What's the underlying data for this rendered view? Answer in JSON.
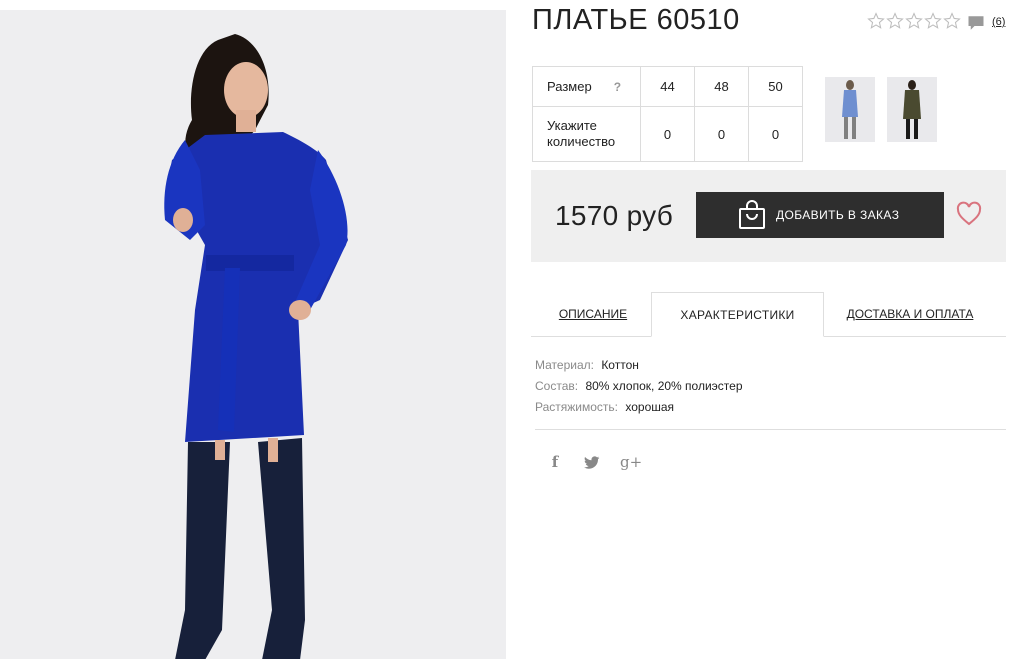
{
  "product": {
    "title": "ПЛАТЬЕ 60510",
    "reviews_count": "(6)",
    "rating": 0,
    "price": "1570 руб",
    "order_button": "ДОБАВИТЬ В ЗАКАЗ"
  },
  "sizes": {
    "size_label": "Размер",
    "help": "?",
    "qty_label": "Укажите количество",
    "columns": [
      "44",
      "48",
      "50"
    ],
    "quantities": [
      "0",
      "0",
      "0"
    ]
  },
  "tabs": [
    {
      "label": "ОПИСАНИЕ"
    },
    {
      "label": "ХАРАКТЕРИСТИКИ"
    },
    {
      "label": "ДОСТАВКА И ОПЛАТА"
    }
  ],
  "specs": [
    {
      "key": "Материал:",
      "value": "Коттон"
    },
    {
      "key": "Состав:",
      "value": "80% хлопок, 20% полиэстер"
    },
    {
      "key": "Растяжимость:",
      "value": "хорошая"
    }
  ],
  "share": {
    "facebook": "f",
    "twitter": "t",
    "google": "g+"
  },
  "colors": {
    "dress_blue": "#1a2fb0",
    "button_dark": "#2e2e2e",
    "heart": "#d9737e",
    "panel_bg": "#efefef",
    "thumb1_dress": "#6f8fd0",
    "thumb2_dress": "#4a4a30"
  },
  "icons": [
    "star-icon",
    "comment-icon",
    "shopping-bag-icon",
    "heart-icon",
    "facebook-icon",
    "twitter-icon",
    "google-plus-icon"
  ]
}
